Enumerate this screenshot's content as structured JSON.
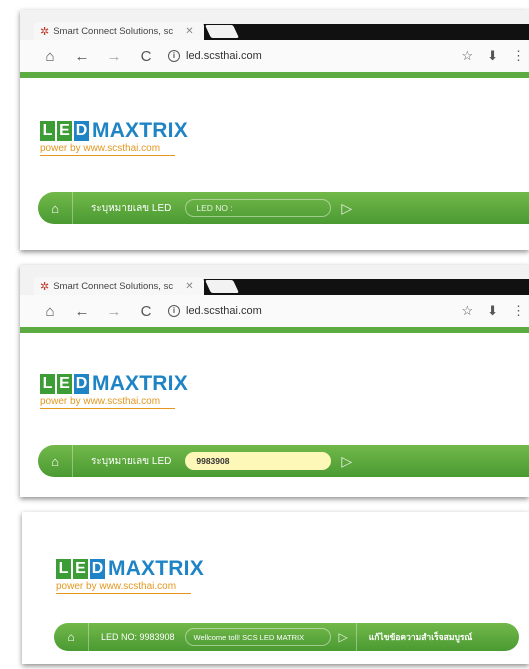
{
  "browser": {
    "tab_title": "Smart Connect Solutions, sc",
    "tab_close": "✕",
    "url": "led.scsthai.com"
  },
  "logo": {
    "letters": [
      "L",
      "E",
      "D"
    ],
    "word": "MAXTRIX",
    "tagline": "power by www.scsthai.com"
  },
  "panel1": {
    "bar_label": "ระบุหมายเลข LED",
    "input_placeholder": "LED NO :"
  },
  "panel2": {
    "bar_label": "ระบุหมายเลข LED",
    "input_value": "9983908"
  },
  "panel3": {
    "led_no": "LED NO: 9983908",
    "message": "Wellcome toll! SCS LED MATRIX",
    "edit_message": "แก้ไขข้อความสำเร็จสมบูรณ์"
  },
  "colors": {
    "brand_green": "#5cab43",
    "brand_blue": "#1f84c5",
    "brand_orange": "#e3971f",
    "input_highlight": "#fdf7b8"
  },
  "icons": [
    "home-icon",
    "back-icon",
    "forward-icon",
    "reload-icon",
    "info-icon",
    "star-icon",
    "download-icon",
    "menu-icon",
    "play-icon"
  ]
}
